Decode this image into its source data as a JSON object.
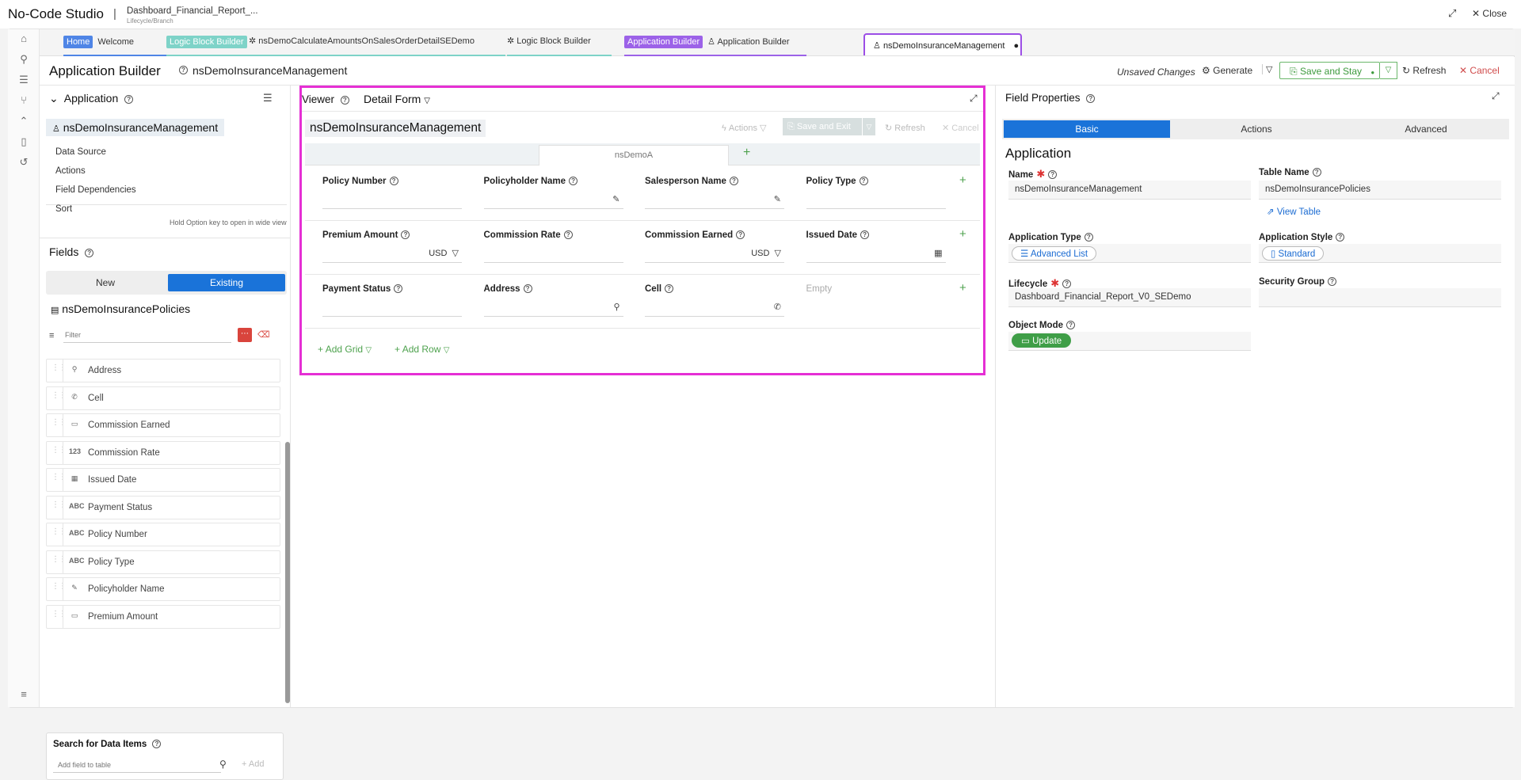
{
  "topbar": {
    "app_title": "No-Code Studio",
    "separator": "|",
    "project_name": "Dashboard_Financial_Report_...",
    "project_sub": "Lifecycle/Branch",
    "close_label": "Close"
  },
  "tabs": [
    {
      "tag": "Home",
      "label": "Welcome",
      "tag_color": "#4f85e6"
    },
    {
      "tag": "Logic Block Builder",
      "tag_color": "#7ed3c8"
    },
    {
      "label": "nsDemoCalculateAmountsOnSalesOrderDetailSEDemo"
    },
    {
      "label": "Logic Block Builder"
    },
    {
      "tag": "Application Builder",
      "label": "Application Builder",
      "tag_color": "#9c62e8"
    },
    {
      "label": "nsDemoInsuranceManagement",
      "active": true
    }
  ],
  "header": {
    "title": "Application Builder",
    "app_name": "nsDemoInsuranceManagement",
    "unsaved": "Unsaved Changes",
    "generate": "Generate",
    "save_and_stay": "Save and Stay",
    "refresh": "Refresh",
    "cancel": "Cancel"
  },
  "left": {
    "application_heading": "Application",
    "app_name": "nsDemoInsuranceManagement",
    "items": [
      "Data Source",
      "Actions",
      "Field Dependencies",
      "Sort"
    ],
    "hint": "Hold Option key to open in wide view",
    "fields_heading": "Fields",
    "seg_new": "New",
    "seg_existing": "Existing",
    "table_name": "nsDemoInsurancePolicies",
    "filter_placeholder": "Filter",
    "fields": [
      {
        "icon": "location-icon",
        "glyph": "⚲",
        "label": "Address"
      },
      {
        "icon": "phone-icon",
        "glyph": "✆",
        "label": "Cell"
      },
      {
        "icon": "currency-icon",
        "glyph": "▭",
        "label": "Commission Earned"
      },
      {
        "icon": "number-icon",
        "glyph": "123",
        "label": "Commission Rate"
      },
      {
        "icon": "calendar-icon",
        "glyph": "▦",
        "label": "Issued Date"
      },
      {
        "icon": "text-icon",
        "glyph": "ABC",
        "label": "Payment Status"
      },
      {
        "icon": "text-icon",
        "glyph": "ABC",
        "label": "Policy Number"
      },
      {
        "icon": "text-icon",
        "glyph": "ABC",
        "label": "Policy Type"
      },
      {
        "icon": "edit-icon",
        "glyph": "✎",
        "label": "Policyholder Name"
      },
      {
        "icon": "currency-icon",
        "glyph": "▭",
        "label": "Premium Amount"
      }
    ],
    "search_heading": "Search for Data Items",
    "search_placeholder": "Add field to table",
    "add_label": "Add"
  },
  "viewer": {
    "title": "Viewer",
    "form_type": "Detail Form",
    "app_name": "nsDemoInsuranceManagement",
    "actions": "Actions",
    "save_exit": "Save and Exit",
    "refresh": "Refresh",
    "cancel": "Cancel",
    "tab": "nsDemoA",
    "rows": [
      [
        {
          "label": "Policy Number"
        },
        {
          "label": "Policyholder Name",
          "icon": "edit-icon",
          "glyph": "✎"
        },
        {
          "label": "Salesperson Name",
          "icon": "edit-icon",
          "glyph": "✎"
        },
        {
          "label": "Policy Type"
        }
      ],
      [
        {
          "label": "Premium Amount",
          "suffix": "USD"
        },
        {
          "label": "Commission Rate"
        },
        {
          "label": "Commission Earned",
          "suffix": "USD"
        },
        {
          "label": "Issued Date",
          "icon": "calendar-icon",
          "glyph": "▦"
        }
      ],
      [
        {
          "label": "Payment Status"
        },
        {
          "label": "Address",
          "icon": "location-icon",
          "glyph": "⚲"
        },
        {
          "label": "Cell",
          "icon": "phone-icon",
          "glyph": "✆"
        },
        {
          "label": "Empty",
          "empty": true
        }
      ]
    ],
    "add_grid": "Add Grid",
    "add_row": "Add Row"
  },
  "properties": {
    "title": "Field Properties",
    "tab_basic": "Basic",
    "tab_actions": "Actions",
    "tab_advanced": "Advanced",
    "section": "Application",
    "name_label": "Name",
    "name_value": "nsDemoInsuranceManagement",
    "table_label": "Table Name",
    "table_value": "nsDemoInsurancePolicies",
    "view_table": "View Table",
    "type_label": "Application Type",
    "type_value": "Advanced List",
    "style_label": "Application Style",
    "style_value": "Standard",
    "lifecycle_label": "Lifecycle",
    "lifecycle_value": "Dashboard_Financial_Report_V0_SEDemo",
    "security_label": "Security Group",
    "mode_label": "Object Mode",
    "mode_value": "Update"
  }
}
